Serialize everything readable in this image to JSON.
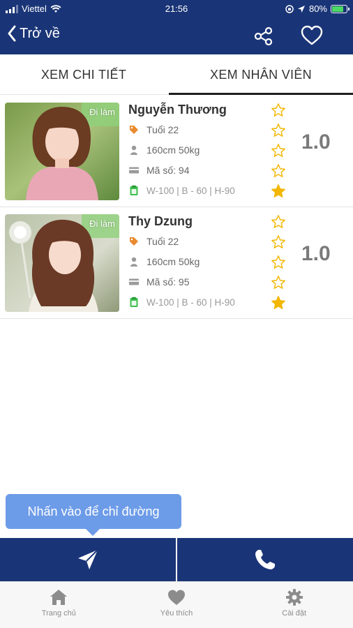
{
  "status_bar": {
    "carrier": "Viettel",
    "time": "21:56",
    "battery": "80%"
  },
  "header": {
    "back_label": "Trở về",
    "share_icon": "share-icon",
    "favorite_icon": "heart-outline-icon"
  },
  "tabs": [
    {
      "label": "XEM CHI TIẾT",
      "active": false
    },
    {
      "label": "XEM NHÂN VIÊN",
      "active": true
    }
  ],
  "staff": [
    {
      "name": "Nguyễn Thương",
      "badge": "Đi làm",
      "age": "Tuổi 22",
      "body": "160cm 50kg",
      "code": "Mã số: 94",
      "measurements": "W-100 | B - 60 | H-90",
      "stars_filled": 1,
      "stars_total": 5,
      "rating": "1.0"
    },
    {
      "name": "Thy Dzung",
      "badge": "Đi làm",
      "age": "Tuổi 22",
      "body": "160cm 50kg",
      "code": "Mã số: 95",
      "measurements": "W-100 | B - 60 | H-90",
      "stars_filled": 1,
      "stars_total": 5,
      "rating": "1.0"
    }
  ],
  "tooltip": "Nhấn vào để chỉ đường",
  "actions": {
    "directions_icon": "navigation-arrow-icon",
    "call_icon": "phone-icon"
  },
  "tabbar": [
    {
      "label": "Trang chủ",
      "icon": "home-icon"
    },
    {
      "label": "Yêu thích",
      "icon": "heart-icon"
    },
    {
      "label": "Cài đặt",
      "icon": "gear-icon"
    }
  ],
  "colors": {
    "navy": "#1a3577",
    "star": "#f2b705",
    "tooltip": "#6c9be8",
    "tag_orange": "#e98a2e",
    "green": "#3bbf4a"
  }
}
